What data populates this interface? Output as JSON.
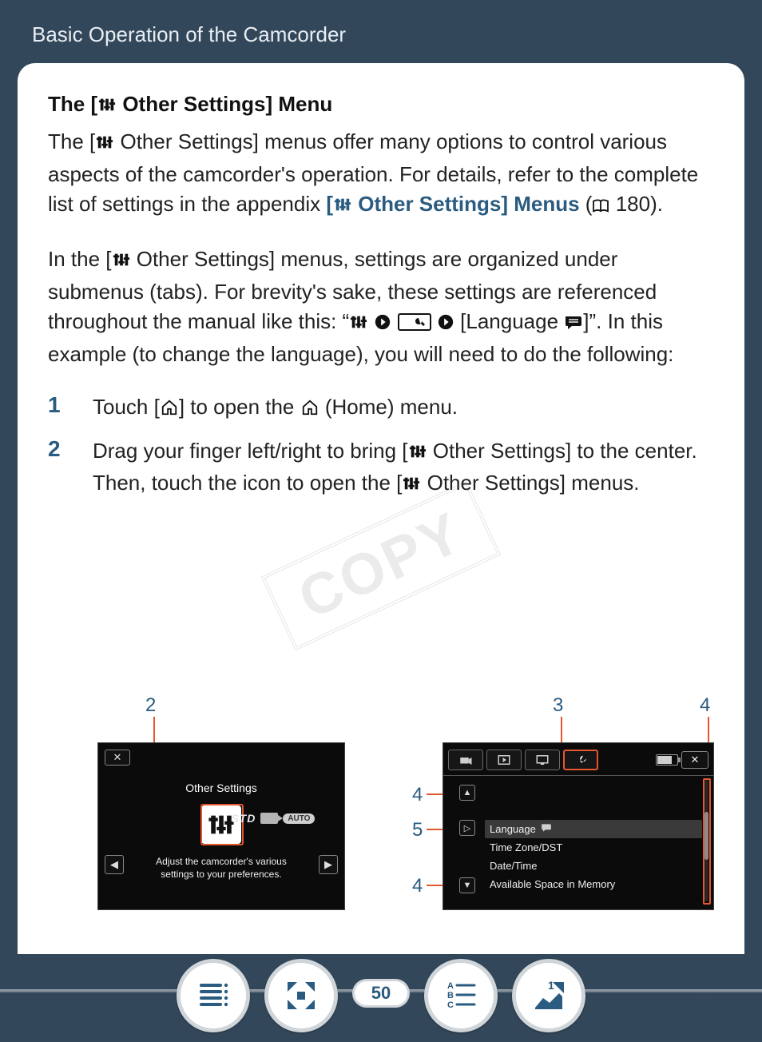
{
  "header": {
    "title": "Basic Operation of the Camcorder"
  },
  "section_title_pre": "The [",
  "section_title_post": " Other Settings] Menu",
  "para1_a": "The [",
  "para1_b": " Other Settings] menus offer many options to control various aspects of the camcorder's operation. For details, refer to the complete list of settings in the appendix ",
  "link_a": "[",
  "link_b": " Other Set­tings] Menus",
  "para1_c": " (",
  "para1_page": " 180).",
  "para2_a": "In the [",
  "para2_b": " Other Settings] menus, settings are organized under submenus (tabs). For brevity's sake, these settings are refer­enced throughout the manual like this: “",
  "para2_c": " [Language ",
  "para2_d": "]”. In this example (to change the language), you will need to do the following:",
  "steps": [
    {
      "num": "1",
      "pre": "Touch [",
      "mid": "] to open the ",
      "post": " (Home) menu."
    },
    {
      "num": "2",
      "pre": "Drag your finger left/right to bring [",
      "mid": " Other Settings] to the center. Then, touch the icon to open the [",
      "post": " Other Settings] menus."
    }
  ],
  "watermark": "COPY",
  "shot1": {
    "title": "Other Settings",
    "desc_line1": "Adjust the camcorder's various",
    "desc_line2": "settings to your preferences.",
    "close": "✕",
    "std": "STD",
    "auto": "AUTO",
    "nav_left": "◀",
    "nav_right": "▶"
  },
  "shot2": {
    "close": "✕",
    "items": [
      "Language",
      "Time Zone/DST",
      "Date/Time",
      "Available Space in Memory"
    ],
    "up": "▲",
    "down": "▼",
    "play": "▷"
  },
  "callouts": {
    "c2": "2",
    "c3": "3",
    "c4": "4",
    "c5": "5"
  },
  "page_number": "50"
}
